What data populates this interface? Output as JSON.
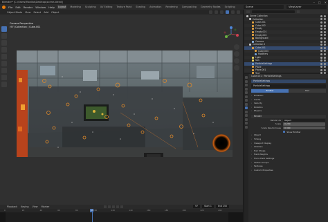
{
  "window": {
    "title": "Blender* [C:\\Users\\Monika\\Desktop\\scene.blend]",
    "min": "–",
    "max": "□",
    "close": "✕"
  },
  "menubar": {
    "menus": [
      "File",
      "Edit",
      "Render",
      "Window",
      "Help"
    ],
    "workspaces": [
      "Layout",
      "Modeling",
      "Sculpting",
      "UV Editing",
      "Texture Paint",
      "Shading",
      "Animation",
      "Rendering",
      "Compositing",
      "Geometry Nodes",
      "Scripting"
    ],
    "active_workspace": "Layout",
    "scene": "Scene",
    "view_layer": "ViewLayer"
  },
  "viewport": {
    "header_menus": [
      "Object Mode",
      "View",
      "Select",
      "Add",
      "Object"
    ],
    "info_line1": "Camera Perspective",
    "info_line2": "(97) Collection | Cube.001"
  },
  "timeline": {
    "menus": [
      "Playback",
      "Keying",
      "View",
      "Marker"
    ],
    "current_frame": "97",
    "start": "Start 1",
    "end": "End 250",
    "ticks": [
      "0",
      "20",
      "40",
      "60",
      "80",
      "100",
      "120",
      "140",
      "160",
      "180",
      "200",
      "220",
      "240"
    ]
  },
  "outliner": {
    "rows": [
      {
        "label": "Scene Collection",
        "indent": 0,
        "icon_color": "#bfbfbf",
        "selected": false
      },
      {
        "label": "Collection",
        "indent": 1,
        "icon_color": "#bfbfbf",
        "selected": false
      },
      {
        "label": "Cube.001",
        "indent": 2,
        "icon_color": "#e0a040",
        "selected": false
      },
      {
        "label": "Cube.002",
        "indent": 2,
        "icon_color": "#e0a040",
        "selected": false
      },
      {
        "label": "Empty",
        "indent": 2,
        "icon_color": "#e0a040",
        "selected": false
      },
      {
        "label": "Empty.001",
        "indent": 2,
        "icon_color": "#e0a040",
        "selected": false
      },
      {
        "label": "Empty.002",
        "indent": 2,
        "icon_color": "#e0a040",
        "selected": false
      },
      {
        "label": "Background",
        "indent": 2,
        "icon_color": "#e0a040",
        "selected": false
      },
      {
        "label": "Camera",
        "indent": 2,
        "icon_color": "#8cb4e0",
        "selected": false
      },
      {
        "label": "Collection 2",
        "indent": 1,
        "icon_color": "#bfbfbf",
        "selected": false
      },
      {
        "label": "Cube.001",
        "indent": 2,
        "icon_color": "#e0a040",
        "selected": true
      },
      {
        "label": "Cube.003",
        "indent": 3,
        "icon_color": "#e0a040",
        "selected": false
      },
      {
        "label": "Modifiers",
        "indent": 3,
        "icon_color": "#6fa0d8",
        "selected": false
      },
      {
        "label": "Light",
        "indent": 2,
        "icon_color": "#e8d060",
        "selected": false
      },
      {
        "label": "Sun",
        "indent": 2,
        "icon_color": "#e8d060",
        "selected": false
      },
      {
        "label": "ParticleSettings",
        "indent": 2,
        "icon_color": "#6fa0d8",
        "selected": true
      },
      {
        "label": "Plane",
        "indent": 2,
        "icon_color": "#e0a040",
        "selected": false
      },
      {
        "label": "Plane.001",
        "indent": 2,
        "icon_color": "#e0a040",
        "selected": false
      },
      {
        "label": "Text",
        "indent": 2,
        "icon_color": "#e0a040",
        "selected": false
      }
    ]
  },
  "properties": {
    "breadcrumb": "Cube.001 › ParticleSettings",
    "system_name": "ParticleSettings",
    "settings_name": "ParticleSettings",
    "subtabs": [
      "Emitter",
      "Hair"
    ],
    "active_subtab": "Emitter",
    "sections_top": [
      "Emission",
      "Cache",
      "Velocity",
      "Rotation",
      "Physics"
    ],
    "render_section": "Render",
    "render_as_label": "Render As",
    "render_as_value": "Object",
    "scale_label": "Scale",
    "scale_value": "0.230",
    "scale_rand_label": "Scale Randomness",
    "scale_rand_value": "0.300",
    "show_emitter": "Show Emitter",
    "sections_bottom": [
      "Object",
      "Timing",
      "Viewport Display",
      "Children",
      "Hair Shape",
      "Field Weights",
      "Force Field Settings",
      "Vertex Groups",
      "Textures",
      "Custom Properties"
    ]
  }
}
